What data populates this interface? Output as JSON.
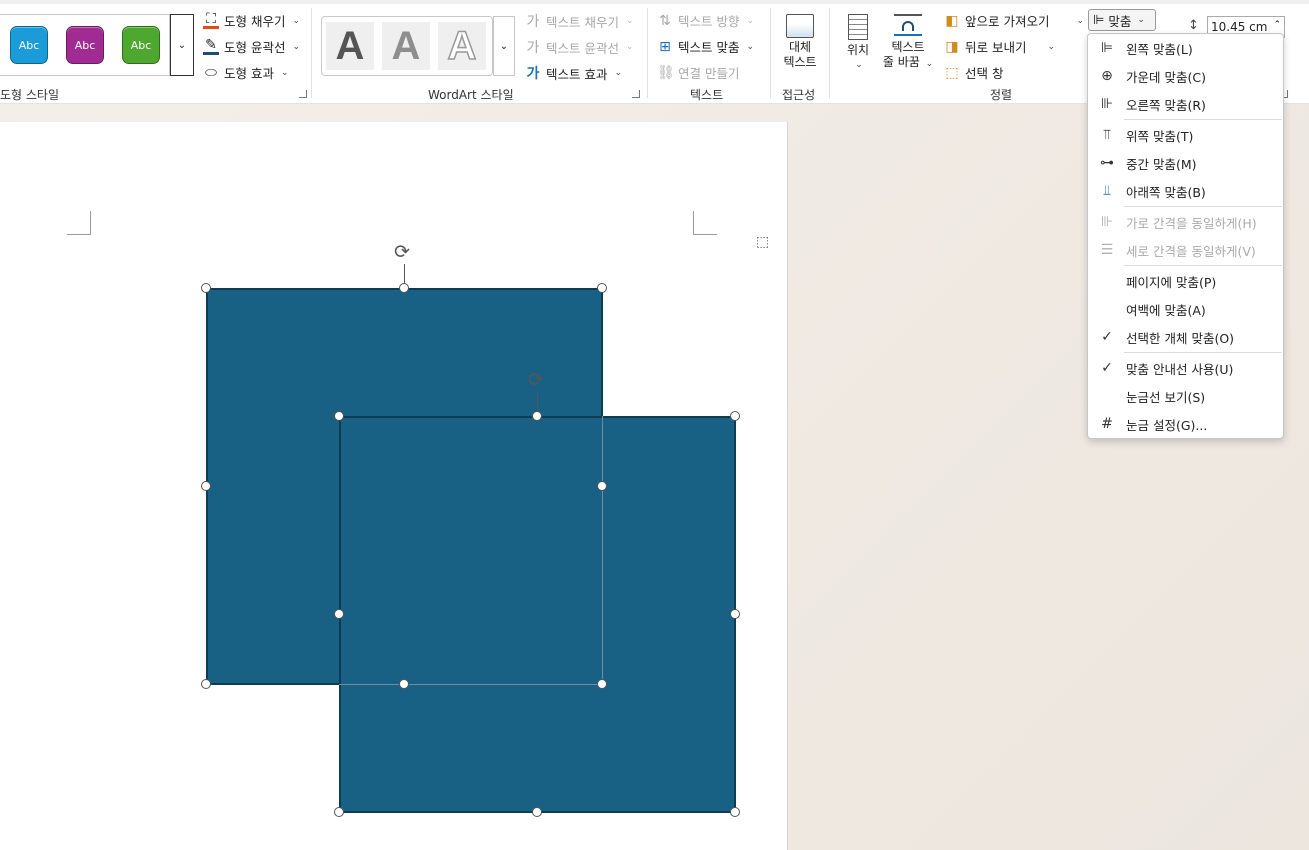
{
  "ribbon": {
    "shape_styles": {
      "swatches": [
        {
          "label": "Abc",
          "color": "#1b9bd7"
        },
        {
          "label": "Abc",
          "color": "#a02b93"
        },
        {
          "label": "Abc",
          "color": "#4ea72e"
        }
      ],
      "commands": [
        {
          "label": "도형 채우기",
          "icon": "paint-bucket-icon",
          "caret": "⌄"
        },
        {
          "label": "도형 윤곽선",
          "icon": "pen-outline-icon",
          "caret": "⌄"
        },
        {
          "label": "도형 효과",
          "icon": "eraser-effect-icon",
          "caret": "⌄"
        }
      ],
      "group_label": "도형 스타일"
    },
    "wordart": {
      "letters": [
        "A",
        "A",
        "A"
      ],
      "commands": [
        {
          "label": "텍스트 채우기",
          "icon": "text-fill-icon",
          "caret": "⌄"
        },
        {
          "label": "텍스트 윤곽선",
          "icon": "text-outline-icon",
          "caret": "⌄"
        },
        {
          "label": "텍스트 효과",
          "icon": "text-effect-icon",
          "caret": "⌄"
        }
      ],
      "group_label": "WordArt 스타일"
    },
    "text": {
      "commands": [
        {
          "label": "텍스트 방향",
          "icon": "text-direction-icon",
          "caret": "⌄"
        },
        {
          "label": "텍스트 맞춤",
          "icon": "text-align-icon",
          "caret": "⌄"
        },
        {
          "label": "연결 만들기",
          "icon": "link-icon",
          "caret": ""
        }
      ],
      "group_label": "텍스트"
    },
    "accessibility": {
      "alt_text_line1": "대체",
      "alt_text_line2": "텍스트",
      "group_label": "접근성"
    },
    "arrange": {
      "position_label": "위치",
      "wrap_line1": "텍스트",
      "wrap_line2": "줄 바꿈",
      "bring_forward": "앞으로 가져오기",
      "send_backward": "뒤로 보내기",
      "selection_pane": "선택 창",
      "align_label": "맞춤",
      "group_label": "정렬"
    },
    "size": {
      "height_value": "10.45 cm"
    }
  },
  "align_menu": {
    "items": [
      {
        "label": "왼쪽 맞춤(L)",
        "icon": "align-left-icon",
        "enabled": true
      },
      {
        "label": "가운데 맞춤(C)",
        "icon": "align-center-icon",
        "enabled": true
      },
      {
        "label": "오른쪽 맞춤(R)",
        "icon": "align-right-icon",
        "enabled": true
      },
      {
        "label": "위쪽 맞춤(T)",
        "icon": "align-top-icon",
        "enabled": true
      },
      {
        "label": "중간 맞춤(M)",
        "icon": "align-middle-icon",
        "enabled": true
      },
      {
        "label": "아래쪽 맞춤(B)",
        "icon": "align-bottom-icon",
        "enabled": true
      },
      {
        "label": "가로 간격을 동일하게(H)",
        "icon": "distribute-horizontal-icon",
        "enabled": false
      },
      {
        "label": "세로 간격을 동일하게(V)",
        "icon": "distribute-vertical-icon",
        "enabled": false
      },
      {
        "label": "페이지에 맞춤(P)",
        "icon": "",
        "enabled": true
      },
      {
        "label": "여백에 맞춤(A)",
        "icon": "",
        "enabled": true
      },
      {
        "label": "선택한 개체 맞춤(O)",
        "icon": "check-icon",
        "enabled": true,
        "checked": true
      },
      {
        "label": "맞춤 안내선 사용(U)",
        "icon": "check-icon",
        "enabled": true,
        "checked": true
      },
      {
        "label": "눈금선 보기(S)",
        "icon": "",
        "enabled": true
      },
      {
        "label": "눈금 설정(G)...",
        "icon": "grid-settings-icon",
        "enabled": true
      }
    ]
  },
  "document": {
    "shape_fill": "#186185",
    "shape_border": "#0e3c52"
  }
}
